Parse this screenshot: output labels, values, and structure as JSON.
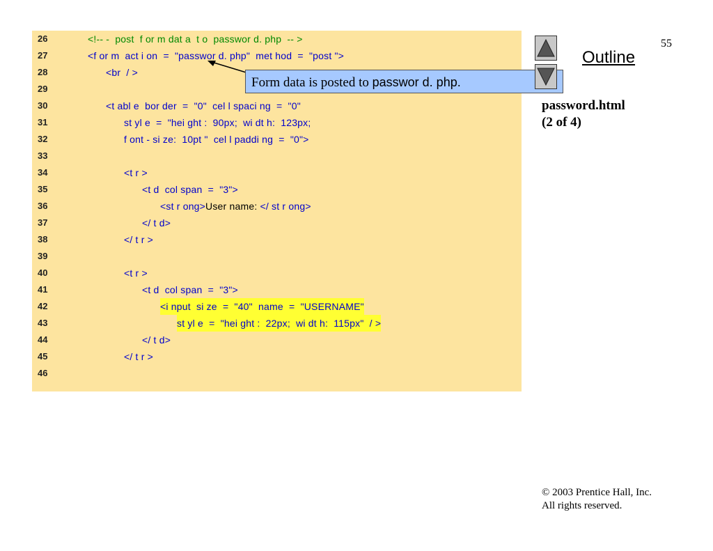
{
  "slide": {
    "page_number": "55",
    "outline_label": "Outline",
    "file_title": "password.html",
    "file_part": "(2 of 4)",
    "copyright": "© 2003 Prentice Hall, Inc.",
    "rights": "All rights reserved."
  },
  "navigation": {
    "up_icon": "triangle-up-icon",
    "down_icon": "triangle-down-icon"
  },
  "callout": {
    "text_before": "Form data is posted to ",
    "code_text": "passwor d. php."
  },
  "code": {
    "lines": [
      {
        "num": "26",
        "text": "<!-- -  post  f or m dat a  t o  passwor d. php  -- >"
      },
      {
        "num": "27",
        "text": "<f or m  act i on  =  \"passwor d. php\"  met hod  =  \"post \">"
      },
      {
        "num": "28",
        "text": "<br  / >"
      },
      {
        "num": "29",
        "text": ""
      },
      {
        "num": "30",
        "text": "<t abl e  bor der  =  \"0\"  cel l spaci ng  =  \"0\""
      },
      {
        "num": "31",
        "text": "st yl e  =  \"hei ght :  90px;  wi dt h:  123px;"
      },
      {
        "num": "32",
        "text": "f ont - si ze:  10pt \"  cel l paddi ng  =  \"0\">"
      },
      {
        "num": "33",
        "text": ""
      },
      {
        "num": "34",
        "text": "<t r >"
      },
      {
        "num": "35",
        "text": "<t d  col span  =  \"3\">"
      },
      {
        "num": "36",
        "text_tag_open": "<st r ong>",
        "text_content": "User name:",
        "text_tag_close": " </ st r ong>"
      },
      {
        "num": "37",
        "text": "</ t d>"
      },
      {
        "num": "38",
        "text": "</ t r >"
      },
      {
        "num": "39",
        "text": ""
      },
      {
        "num": "40",
        "text": "<t r >"
      },
      {
        "num": "41",
        "text": "<t d  col span  =  \"3\">"
      },
      {
        "num": "42",
        "text": "<i nput  si ze  =  \"40\"  name  =  \"USERNAME\""
      },
      {
        "num": "43",
        "text": "st yl e  =  \"hei ght :  22px;  wi dt h:  115px\"  / >"
      },
      {
        "num": "44",
        "text": "</ t d>"
      },
      {
        "num": "45",
        "text": "</ t r >"
      },
      {
        "num": "46",
        "text": ""
      }
    ]
  },
  "colors": {
    "code_background": "#fde49f",
    "comment": "#008800",
    "markup": "#0000cc",
    "highlight": "#ffff33",
    "callout_background": "#a6c9ff"
  }
}
